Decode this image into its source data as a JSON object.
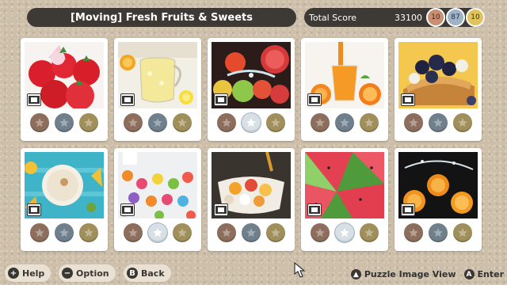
{
  "header": {
    "title": "[Moving] Fresh Fruits & Sweets",
    "score_label": "Total Score",
    "score_value": "33100",
    "medals": [
      {
        "type": "bronze",
        "count": "10",
        "color": "#c98f73"
      },
      {
        "type": "silver",
        "count": "87",
        "color": "#9fb3c6"
      },
      {
        "type": "gold",
        "count": "10",
        "color": "#e1c35d"
      }
    ]
  },
  "puzzles": [
    {
      "subject": "strawberries",
      "icon": "movie-icon",
      "silver_earned": false
    },
    {
      "subject": "lemonade-pitcher",
      "icon": "movie-icon",
      "silver_earned": false
    },
    {
      "subject": "fruit-splash",
      "icon": "movie-icon",
      "silver_earned": true
    },
    {
      "subject": "orange-juice",
      "icon": "movie-icon",
      "silver_earned": false
    },
    {
      "subject": "berry-pastry",
      "icon": "movie-icon",
      "silver_earned": false
    },
    {
      "subject": "smoothie-bowl",
      "icon": "movie-icon",
      "silver_earned": false
    },
    {
      "subject": "cereal-milk",
      "icon": "movie-icon",
      "silver_earned": true
    },
    {
      "subject": "fruit-yogurt",
      "icon": "movie-icon",
      "silver_earned": false
    },
    {
      "subject": "watermelon",
      "icon": "movie-icon",
      "silver_earned": true
    },
    {
      "subject": "orange-splash",
      "icon": "movie-icon",
      "silver_earned": false
    }
  ],
  "footer": {
    "help_glyph": "+",
    "help_label": "Help",
    "option_glyph": "−",
    "option_label": "Option",
    "back_glyph": "B",
    "back_label": "Back",
    "view_glyph": "▲",
    "view_label": "Puzzle Image View",
    "enter_glyph": "A",
    "enter_label": "Enter"
  }
}
